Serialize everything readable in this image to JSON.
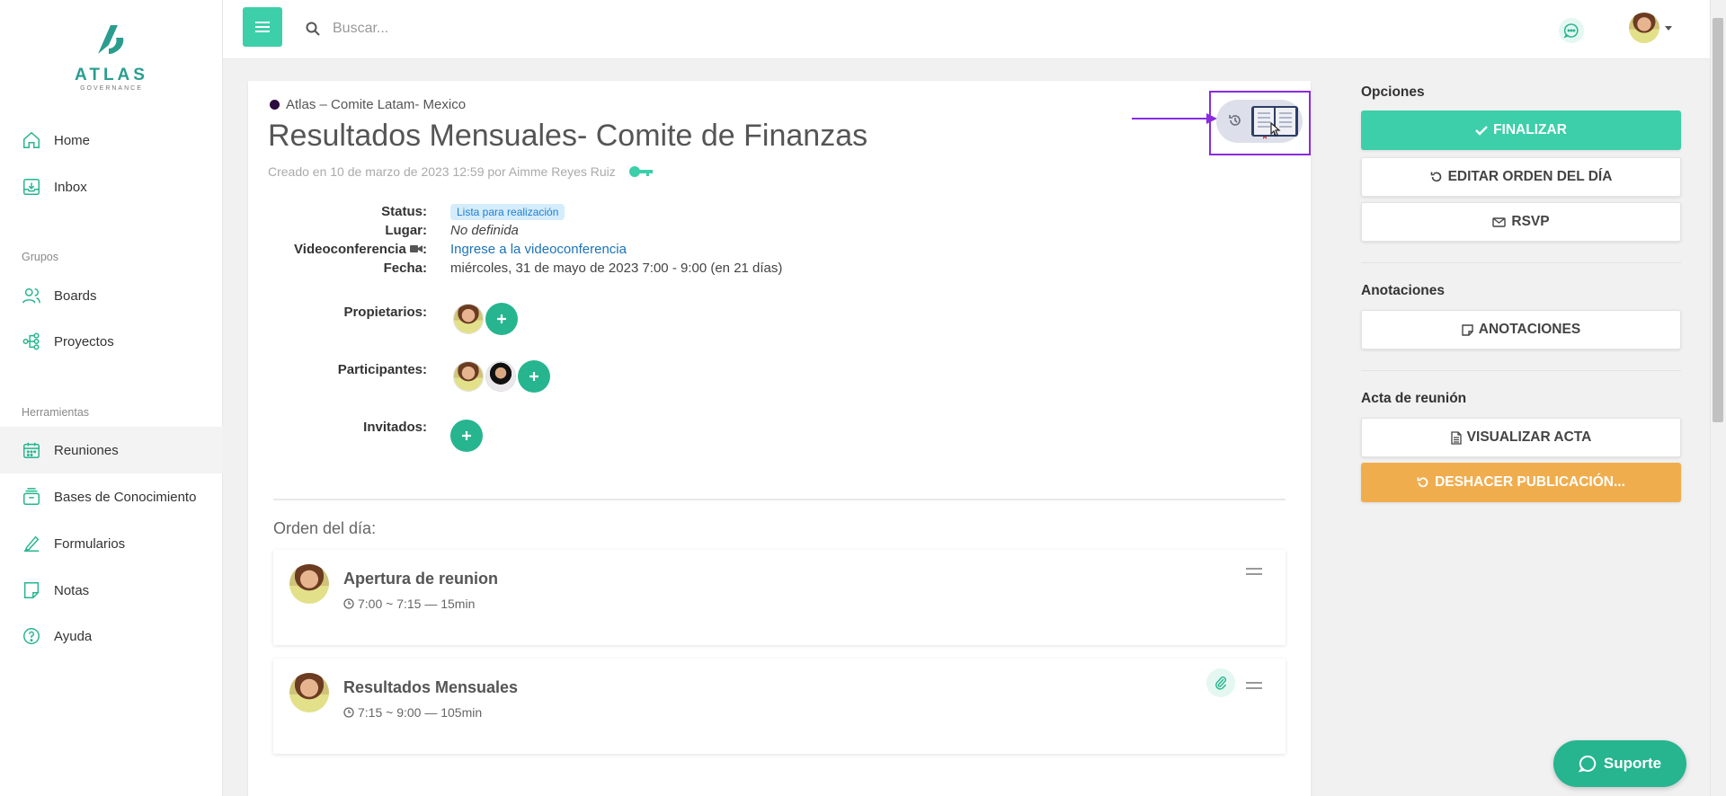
{
  "sidebar": {
    "logo_text": "ATLAS",
    "logo_sub": "GOVERNANCE",
    "items": [
      {
        "label": "Home",
        "icon": "home-icon"
      },
      {
        "label": "Inbox",
        "icon": "inbox-icon"
      },
      {
        "label": "Boards",
        "icon": "users-icon"
      },
      {
        "label": "Proyectos",
        "icon": "project-icon"
      },
      {
        "label": "Reuniones",
        "icon": "calendar-icon"
      },
      {
        "label": "Bases de Conocimiento",
        "icon": "archive-icon"
      },
      {
        "label": "Formularios",
        "icon": "form-icon"
      },
      {
        "label": "Notas",
        "icon": "note-icon"
      },
      {
        "label": "Ayuda",
        "icon": "help-icon"
      }
    ],
    "groups": {
      "grupos": "Grupos",
      "herramientas": "Herramientas"
    }
  },
  "topbar": {
    "search_placeholder": "Buscar..."
  },
  "meeting": {
    "organization": "Atlas – Comite Latam- Mexico",
    "title": "Resultados Mensuales- Comite de Finanzas",
    "created": "Creado en 10 de marzo de 2023 12:59 por Aimme Reyes Ruiz",
    "labels": {
      "status": "Status:",
      "lugar": "Lugar:",
      "video": "Videoconferencia",
      "video_suffix": ":",
      "fecha": "Fecha:",
      "propietarios": "Propietarios:",
      "participantes": "Participantes:",
      "invitados": "Invitados:"
    },
    "status": "Lista para realización",
    "lugar": "No definida",
    "video_link": "Ingrese a la videoconferencia",
    "fecha": "miércoles, 31 de mayo de 2023 7:00 - 9:00 (en 21 días)",
    "agenda_title": "Orden del día:",
    "agenda": [
      {
        "title": "Apertura de reunion",
        "time": "7:00 ~ 7:15 — 15min"
      },
      {
        "title": "Resultados Mensuales",
        "time": "7:15 ~ 9:00 — 105min"
      }
    ]
  },
  "panel": {
    "opciones": "Opciones",
    "finalizar": "FINALIZAR",
    "editar": "EDITAR ORDEN DEL DÍA",
    "rsvp": "RSVP",
    "anotaciones_label": "Anotaciones",
    "anotaciones": "ANOTACIONES",
    "acta_label": "Acta de reunión",
    "visualizar": "VISUALIZAR ACTA",
    "deshacer": "DESHACER PUBLICACIÓN..."
  },
  "support": "Suporte",
  "colors": {
    "accent": "#3ccfa9",
    "support": "#26b58f",
    "warning": "#f0ad4e",
    "highlight": "#8a2be2"
  }
}
